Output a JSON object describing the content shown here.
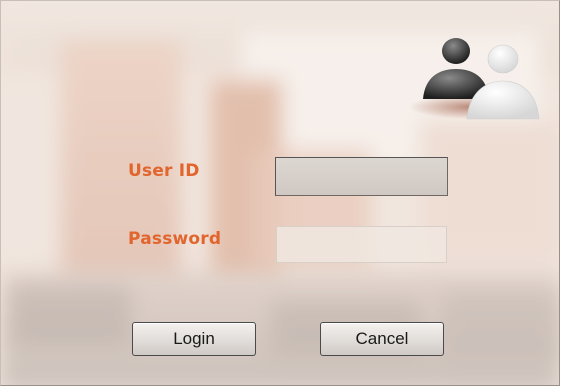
{
  "form": {
    "user_id_label": "User ID",
    "password_label": "Password",
    "user_id_value": "",
    "password_value": ""
  },
  "buttons": {
    "login_label": "Login",
    "cancel_label": "Cancel"
  },
  "icons": {
    "users": "users-icon"
  },
  "colors": {
    "label": "#e1652d",
    "button_border": "#4a4a4a"
  }
}
